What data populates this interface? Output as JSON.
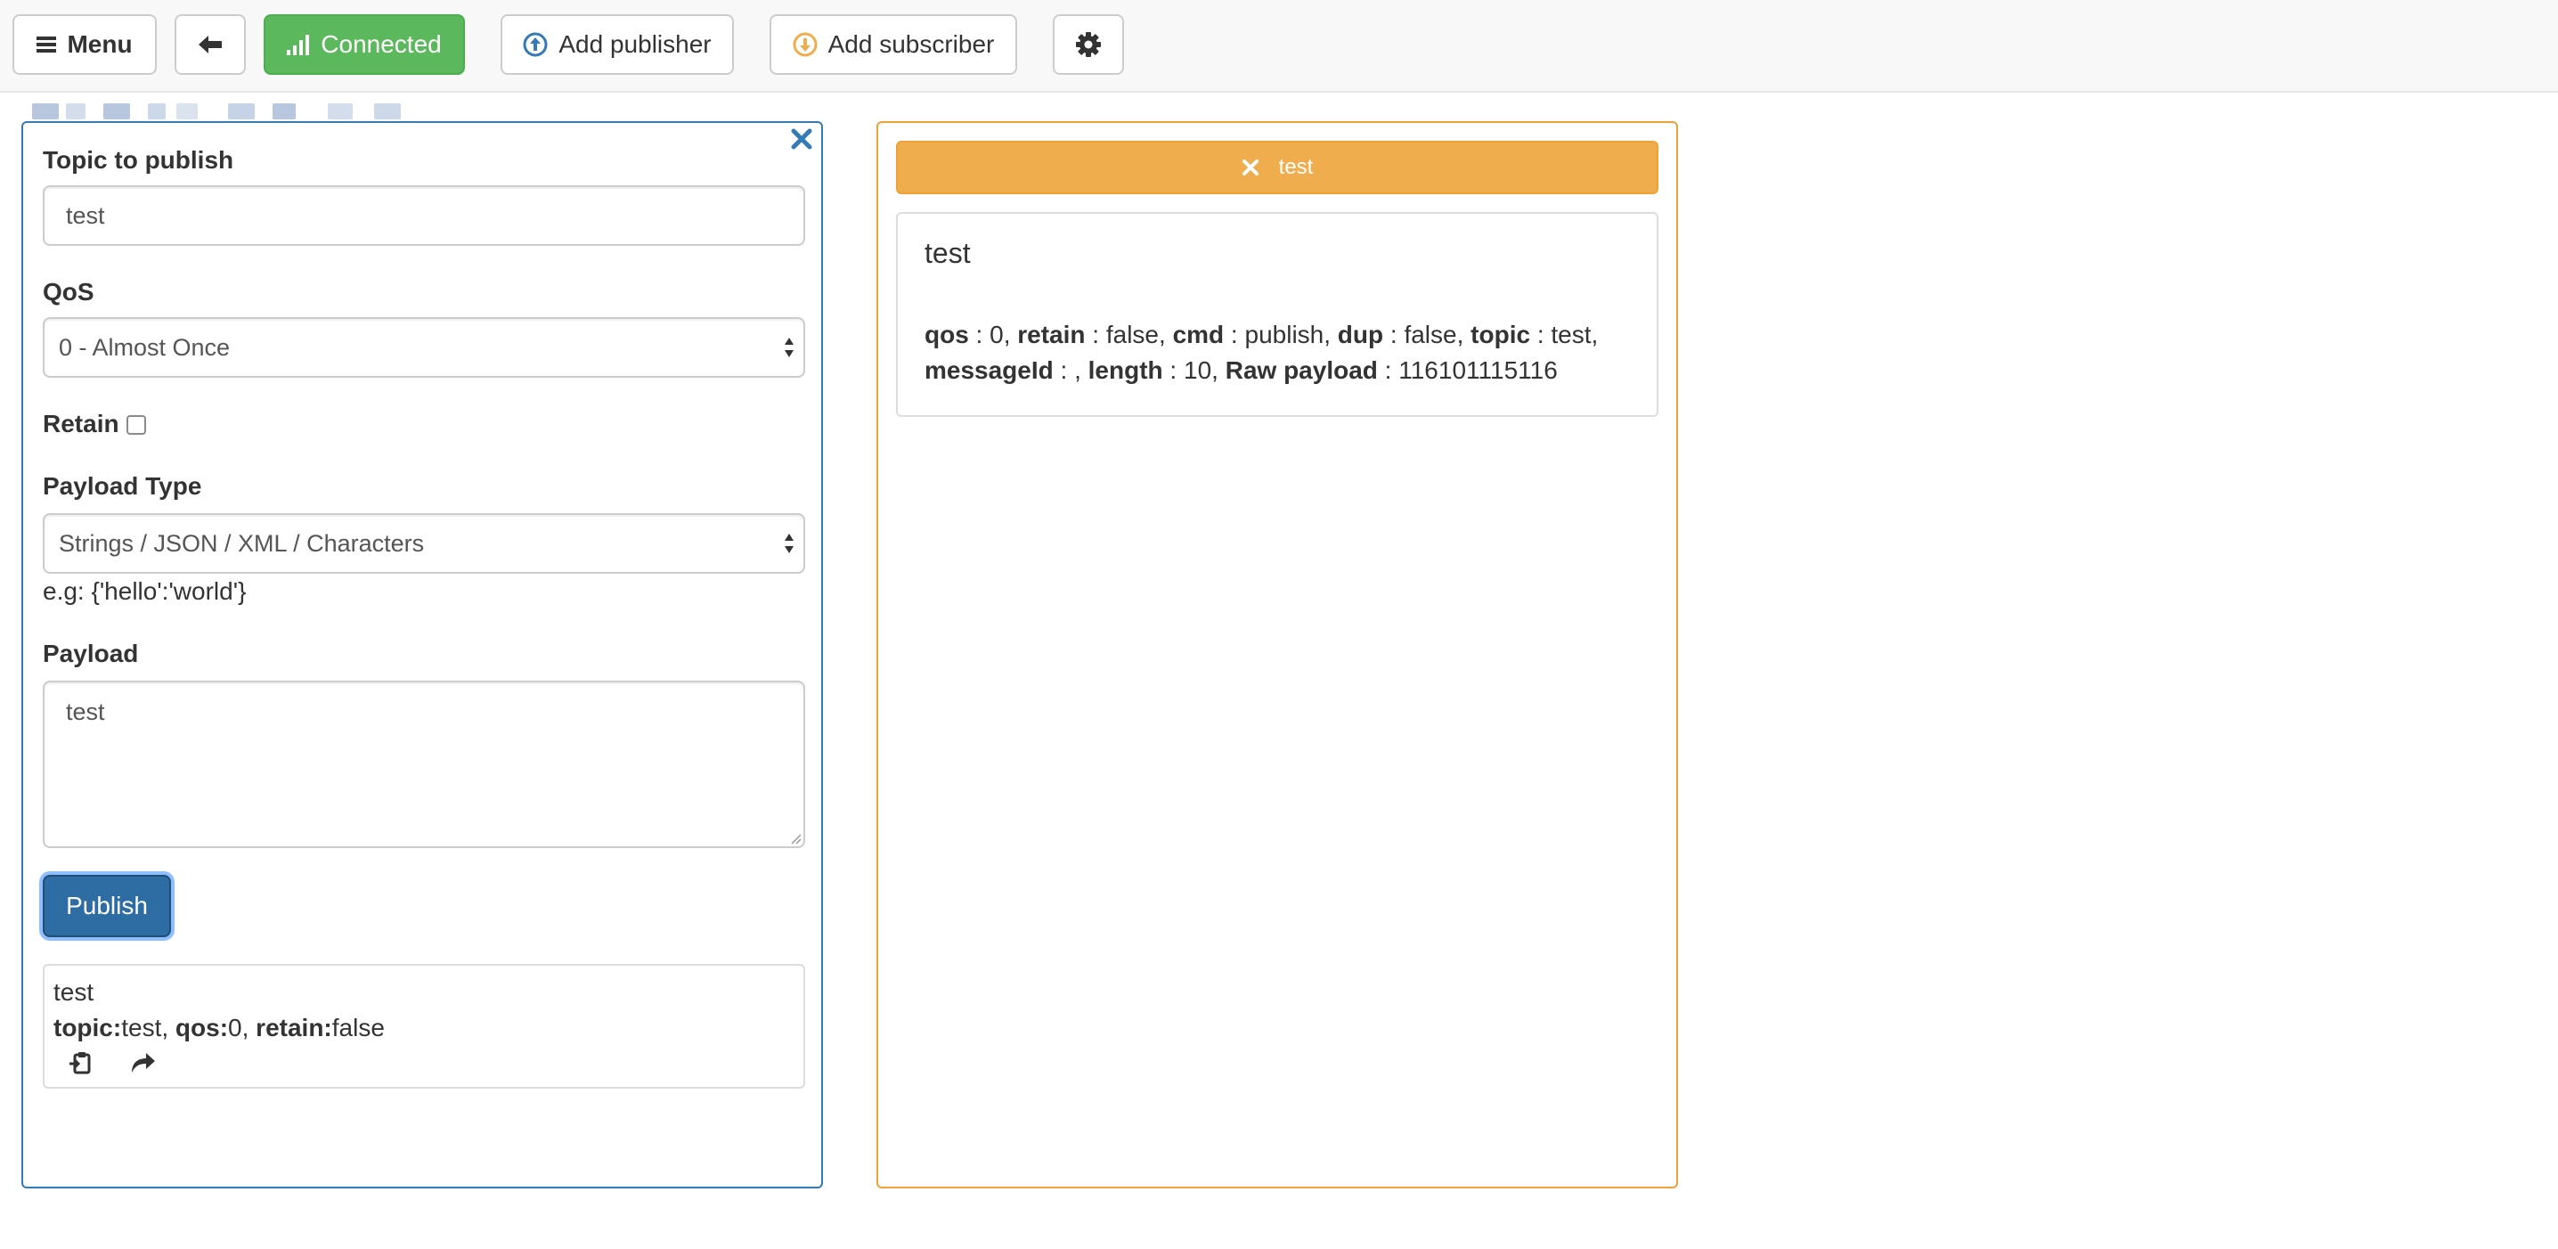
{
  "toolbar": {
    "menu_label": "Menu",
    "connected_label": "Connected",
    "add_publisher_label": "Add publisher",
    "add_subscriber_label": "Add subscriber"
  },
  "publisher": {
    "topic_label": "Topic to publish",
    "topic_value": "test",
    "qos_label": "QoS",
    "qos_selected": "0 - Almost Once",
    "retain_label": "Retain",
    "retain_checked": false,
    "payload_type_label": "Payload Type",
    "payload_type_selected": "Strings / JSON / XML / Characters",
    "payload_hint": "e.g: {'hello':'world'}",
    "payload_label": "Payload",
    "payload_value": "test",
    "publish_label": "Publish",
    "history": {
      "message": "test",
      "topic_key": "topic:",
      "topic_value": "test",
      "qos_key": "qos:",
      "qos_value": "0",
      "retain_key": "retain:",
      "retain_value": "false"
    }
  },
  "subscriber": {
    "topic": "test",
    "message": {
      "payload": "test",
      "qos_key": "qos",
      "qos_value": "0",
      "retain_key": "retain",
      "retain_value": "false",
      "cmd_key": "cmd",
      "cmd_value": "publish",
      "dup_key": "dup",
      "dup_value": "false",
      "topic_key": "topic",
      "topic_value": "test",
      "messageid_key": "messageId",
      "messageid_value": "",
      "length_key": "length",
      "length_value": "10",
      "raw_key": "Raw payload",
      "raw_value": "116101115116"
    }
  },
  "colors": {
    "connected": "#5cb85c",
    "primary": "#337ab7",
    "warning": "#f0ad4e"
  }
}
